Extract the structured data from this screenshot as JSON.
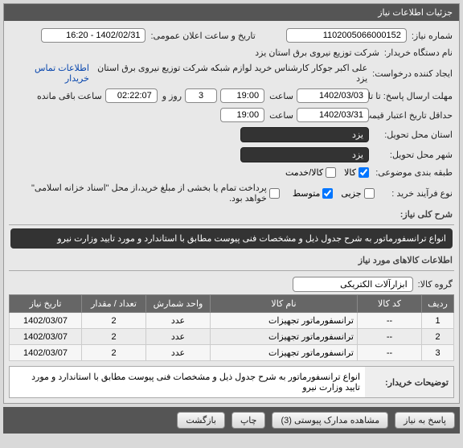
{
  "panel": {
    "title": "جزئیات اطلاعات نیاز"
  },
  "fields": {
    "need_no_label": "شماره نیاز:",
    "need_no": "1102005066000152",
    "public_dt_label": "تاریخ و ساعت اعلان عمومی:",
    "public_dt": "1402/02/31 - 16:20",
    "buyer_org_label": "نام دستگاه خریدار:",
    "buyer_org": "شرکت توزیع نیروی برق استان یزد",
    "requester_label": "ایجاد کننده درخواست:",
    "requester": "علی اکبر جوکار  کارشناس خرید لوازم شبکه  شرکت توزیع نیروی برق استان یزد",
    "buyer_contact_link": "اطلاعات تماس خریدار",
    "deadline_label": "مهلت ارسال پاسخ: تا تاریخ:",
    "deadline_date": "1402/03/03",
    "time_label": "ساعت",
    "deadline_time": "19:00",
    "day_and_word": "روز و",
    "remain_count": "3",
    "remain_time": "02:22:07",
    "remain_suffix": "ساعت باقی مانده",
    "price_valid_label": "حداقل تاریخ اعتبار قیمت: تا تاریخ:",
    "price_valid_date": "1402/03/31",
    "price_valid_time": "19:00",
    "need_province_label": "استان محل تحویل:",
    "need_province": "یزد",
    "need_city_label": "شهر محل تحویل:",
    "need_city": "یزد",
    "subject_class_label": "طبقه بندی موضوعی:",
    "cb_goods": "کالا",
    "cb_service": "کالا/خدمت",
    "buy_process_label": "نوع فرآیند خرید :",
    "cb_small": "جزیی",
    "cb_medium": "متوسط",
    "cb_medium_note": "پرداخت تمام یا بخشی از مبلغ خرید،از محل \"اسناد خزانه اسلامی\" خواهد بود.",
    "general_desc_title": "شرح کلی نیاز:",
    "general_desc": "انواع ترانسفورماتور  به شرح جدول ذیل و مشخصات فنی پیوست مطابق با استاندارد و مورد تایید وزارت نیرو",
    "items_info_title": "اطلاعات کالاهای مورد نیاز",
    "group_label": "گروه کالا:",
    "group_value": "ابزارآلات الکتریکی",
    "buyer_notes_label": "توضیحات خریدار:",
    "buyer_notes": "انواع ترانسفورماتور  به شرح جدول ذیل و مشخصات فنی پیوست مطابق با استاندارد و مورد تایید وزارت نیرو"
  },
  "table": {
    "headers": {
      "row": "ردیف",
      "code": "کد کالا",
      "name": "نام کالا",
      "unit": "واحد شمارش",
      "qty": "تعداد / مقدار",
      "date": "تاریخ نیاز"
    },
    "rows": [
      {
        "row": "1",
        "code": "--",
        "name": "ترانسفورماتور تجهیزات",
        "unit": "عدد",
        "qty": "2",
        "date": "1402/03/07"
      },
      {
        "row": "2",
        "code": "--",
        "name": "ترانسفورماتور تجهیزات",
        "unit": "عدد",
        "qty": "2",
        "date": "1402/03/07"
      },
      {
        "row": "3",
        "code": "--",
        "name": "ترانسفورماتور تجهیزات",
        "unit": "عدد",
        "qty": "2",
        "date": "1402/03/07"
      }
    ]
  },
  "buttons": {
    "respond": "پاسخ به نیاز",
    "attachments": "مشاهده مدارک پیوستی (3)",
    "print": "چاپ",
    "back": "بازگشت"
  }
}
